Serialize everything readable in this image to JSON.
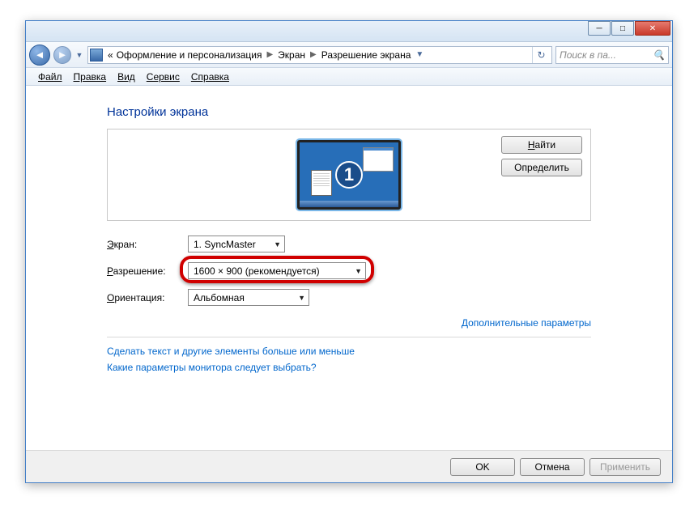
{
  "titlebar": {
    "min": "─",
    "max": "□",
    "close": "✕"
  },
  "nav": {
    "back": "◄",
    "fwd": "►",
    "dd": "▼",
    "prefix": "«",
    "crumb1": "Оформление и персонализация",
    "crumb2": "Экран",
    "crumb3": "Разрешение экрана",
    "refresh_dd": "▼",
    "refresh": "↻"
  },
  "search": {
    "placeholder": "Поиск в па...",
    "icon": "🔍"
  },
  "menu": {
    "file": "Файл",
    "edit": "Правка",
    "view": "Вид",
    "service": "Сервис",
    "help": "Справка"
  },
  "heading": "Настройки экрана",
  "preview_buttons": {
    "find": "Найти",
    "find_u": "Н",
    "identify": "Определить"
  },
  "monitor_number": "1",
  "labels": {
    "screen": "Экран:",
    "screen_u": "Э",
    "resolution": "Разрешение:",
    "resolution_u": "Р",
    "orientation": "Ориентация:",
    "orientation_u": "О"
  },
  "values": {
    "screen": "1. SyncMaster",
    "resolution": "1600 × 900 (рекомендуется)",
    "orientation": "Альбомная"
  },
  "links": {
    "advanced": "Дополнительные параметры",
    "textsize": "Сделать текст и другие элементы больше или меньше",
    "which": "Какие параметры монитора следует выбрать?"
  },
  "footer": {
    "ok": "OK",
    "cancel": "Отмена",
    "apply": "Применить"
  }
}
